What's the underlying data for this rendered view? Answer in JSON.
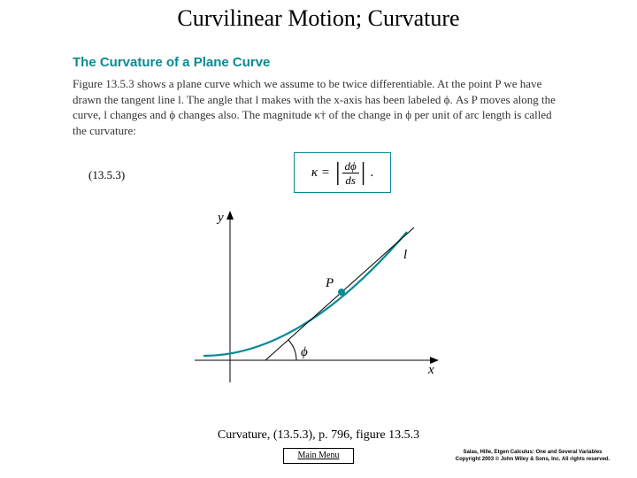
{
  "title": "Curvilinear Motion; Curvature",
  "section_heading": "The Curvature of a Plane Curve",
  "paragraph": "Figure 13.5.3 shows a plane curve which we assume to be twice differentiable. At the point P we have drawn the tangent line l. The angle that l makes with the x-axis has been labeled ϕ. As P moves along the curve, l changes and ϕ changes also. The magnitude κ† of the change in ϕ per unit of arc length is called the curvature:",
  "equation_label": "(13.5.3)",
  "formula": {
    "kappa": "κ =",
    "bar_left": "|",
    "num": "dϕ",
    "den": "ds",
    "bar_right": "|",
    "dot": "."
  },
  "figure": {
    "y_label": "y",
    "x_label": "x",
    "l_label": "l",
    "p_label": "P",
    "phi_label": "ϕ"
  },
  "caption": "Curvature, (13.5.3), p. 796, figure 13.5.3",
  "main_menu_label": "Main Menu",
  "credits_line1": "Salas, Hille, Etgen Calculus: One and Several Variables",
  "credits_line2": "Copyright 2003 © John Wiley & Sons, Inc.  All rights reserved."
}
